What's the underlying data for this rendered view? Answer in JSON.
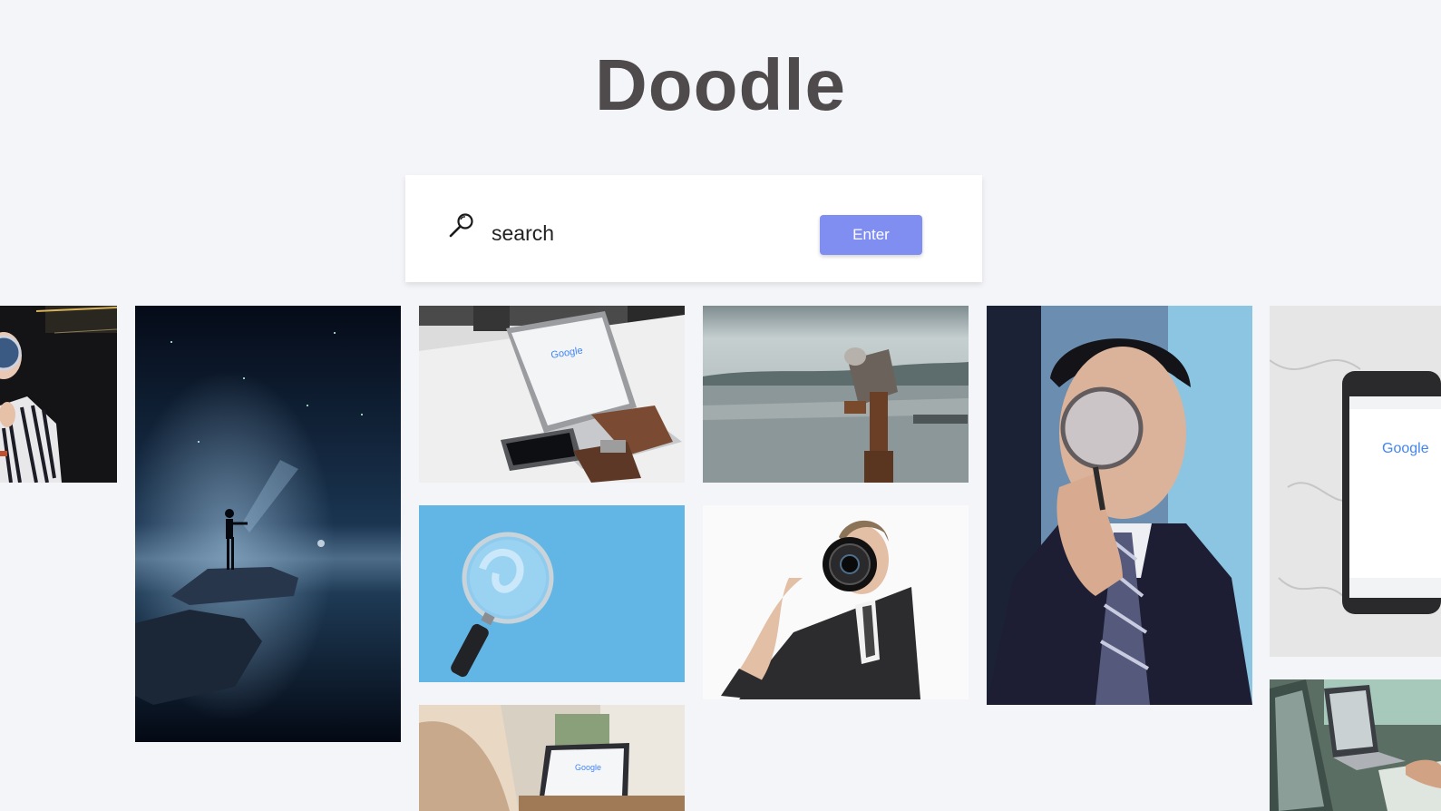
{
  "app": {
    "title": "Doodle"
  },
  "search": {
    "placeholder": "search",
    "value": "",
    "button_label": "Enter"
  },
  "gallery": {
    "images": [
      {
        "name": "person-with-magnifier-cropped",
        "icon": "photo"
      },
      {
        "name": "night-sky-person-on-rock",
        "icon": "photo"
      },
      {
        "name": "laptop-google-search",
        "icon": "photo"
      },
      {
        "name": "telescope-by-lake",
        "icon": "photo"
      },
      {
        "name": "man-with-magnifying-glass",
        "icon": "photo"
      },
      {
        "name": "phone-google-on-marble",
        "icon": "photo"
      },
      {
        "name": "magnifying-glass-blue",
        "icon": "photo"
      },
      {
        "name": "man-with-camera-lens",
        "icon": "photo"
      },
      {
        "name": "person-using-laptop",
        "icon": "photo"
      },
      {
        "name": "laptops-on-desk",
        "icon": "photo"
      }
    ]
  },
  "colors": {
    "background": "#f4f5f9",
    "title": "#4f4a4b",
    "accent": "#7f8ef0"
  },
  "photo_text": {
    "google_logo": "Google"
  }
}
